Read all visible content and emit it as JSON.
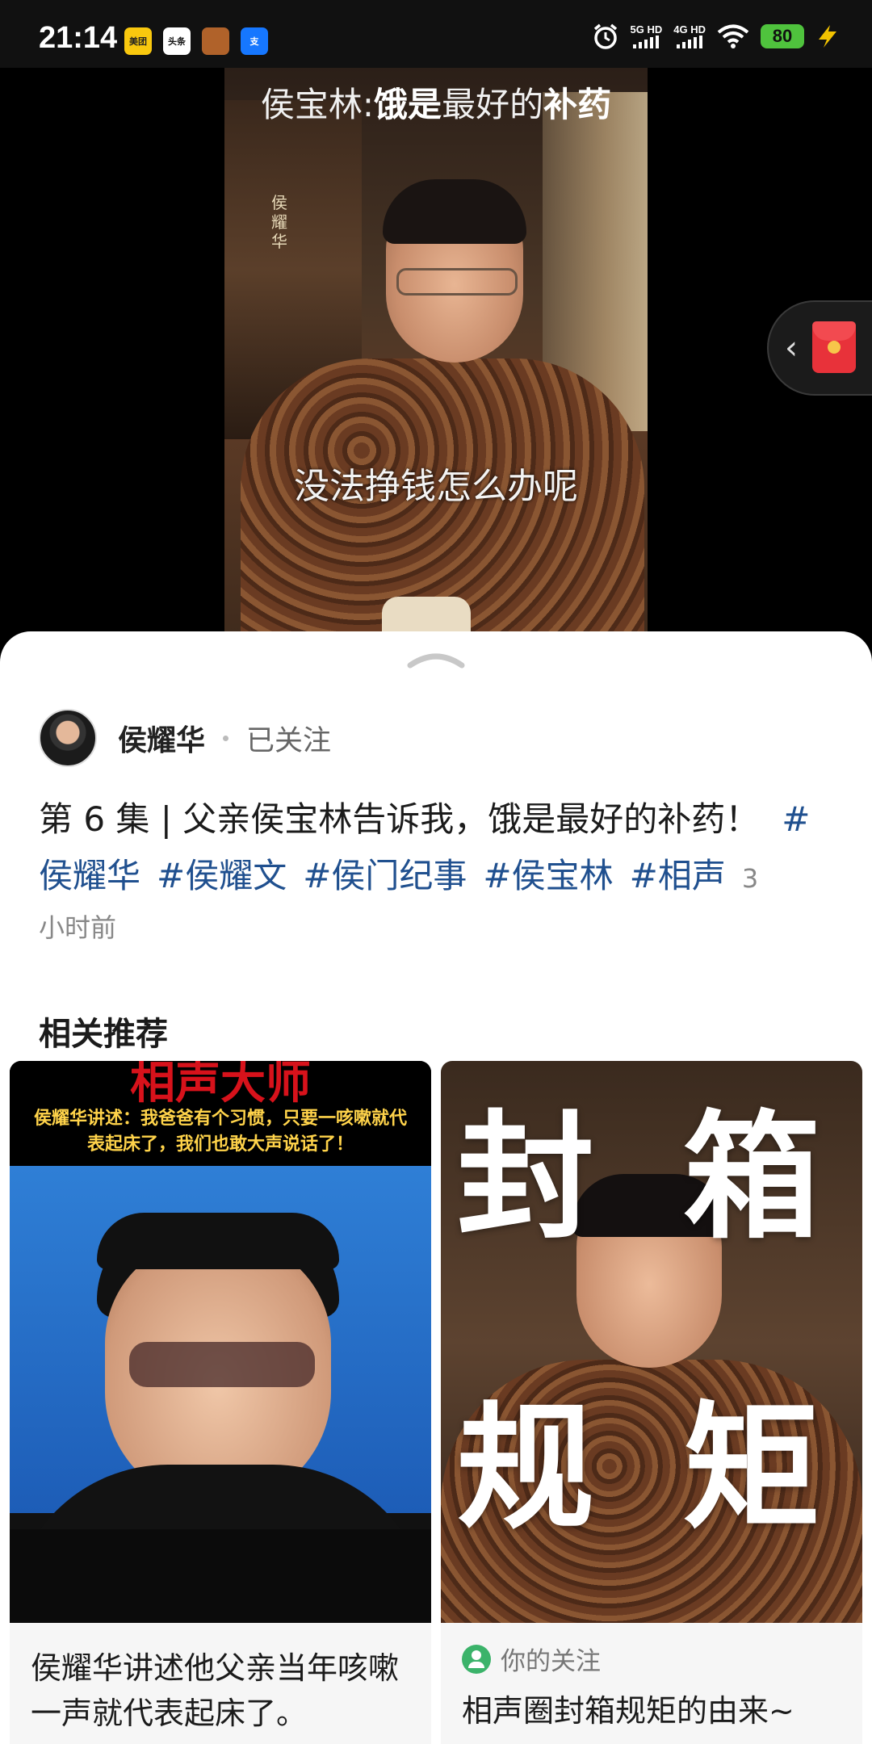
{
  "status_bar": {
    "time": "21:14",
    "apps": [
      {
        "name": "meituan-app-icon",
        "label": "美团",
        "bg": "#f9c80e",
        "fg": "#222"
      },
      {
        "name": "toutiao-app-icon",
        "label": "头条",
        "bg": "#ffffff",
        "fg": "#111"
      },
      {
        "name": "game-app-icon",
        "label": "",
        "bg": "#b0622a",
        "fg": "#fff"
      },
      {
        "name": "alipay-app-icon",
        "label": "支",
        "bg": "#1677ff",
        "fg": "#fff"
      }
    ],
    "network1": "5G HD",
    "network2": "4G HD",
    "battery": "80"
  },
  "video": {
    "title_part1": "侯宝林:",
    "title_part2": "饿是",
    "title_part3": "最好的",
    "title_part4": "补药",
    "subtitle": "没法挣钱怎么办呢",
    "side_text": "侯耀华"
  },
  "author": {
    "name": "侯耀华",
    "follow_status": "已关注"
  },
  "post": {
    "description": "第 6 集 | 父亲侯宝林告诉我，饿是最好的补药！",
    "tags": [
      "#侯耀华",
      "#侯耀文",
      "#侯门纪事",
      "#侯宝林",
      "#相声"
    ],
    "time_ago_num": "3",
    "time_ago_unit": "小时前"
  },
  "recommendations": {
    "title": "相关推荐",
    "cards": [
      {
        "thumb_headline": "相声大师",
        "thumb_caption": "侯耀华讲述：我爸爸有个习惯，只要一咳嗽就代表起床了，我们也敢大声说话了！",
        "text": "侯耀华讲述他父亲当年咳嗽一声就代表起床了。"
      },
      {
        "thumb_chars": [
          "封",
          "箱",
          "规",
          "矩"
        ],
        "badge": "你的关注",
        "text": "相声圈封箱规矩的由来~"
      }
    ]
  }
}
